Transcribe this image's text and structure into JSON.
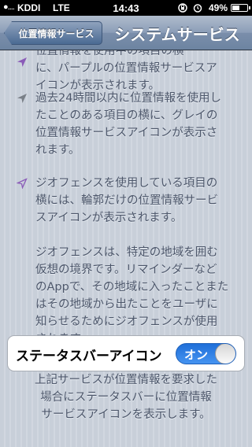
{
  "statusbar": {
    "signal": "●....",
    "carrier": "KDDI",
    "network": "LTE",
    "time": "14:43",
    "battery_percent": "49%",
    "icons": [
      "rotation-lock-icon",
      "alarm-icon",
      "battery-icon"
    ]
  },
  "nav": {
    "back_label": "位置情報サービス",
    "title": "システムサービス"
  },
  "paragraphs": [
    {
      "icon": "location-arrow-purple-icon",
      "icon_color": "#8a5bb8",
      "lines": [
        "位置情報を使用中の項目の横",
        "に、パープルの位置情報サービスア",
        "イコンが表示されます。"
      ]
    },
    {
      "icon": "location-arrow-gray-icon",
      "icon_color": "#7a8088",
      "lines": [
        "過去24時間以内に位置情報を使用し",
        "たことのある項目の横に、グレイの",
        "位置情報サービスアイコンが表示さ",
        "れます。"
      ]
    },
    {
      "icon": "location-arrow-outline-purple-icon",
      "icon_color": "#8a5bb8",
      "lines": [
        "ジオフェンスを使用している項目の",
        "横には、輪郭だけの位置情報サービ",
        "スアイコンが表示されます。"
      ]
    },
    {
      "lines": [
        "ジオフェンスは、特定の地域を囲む",
        "仮想の境界です。リマインダーなど",
        "のAppで、その地域に入ったことまた",
        "はその地域から出たことをユーザに",
        "知らせるためにジオフェンスが使用",
        "されます。"
      ]
    }
  ],
  "setting": {
    "label": "ステータスバーアイコン",
    "switch_label": "オン",
    "switch_state": "on",
    "accent": "#2a7ae2"
  },
  "footer": {
    "lines": [
      "上記サービスが位置情報を要求した",
      "場合にステータスバーに位置情報",
      "サービスアイコンを表示します。"
    ]
  }
}
